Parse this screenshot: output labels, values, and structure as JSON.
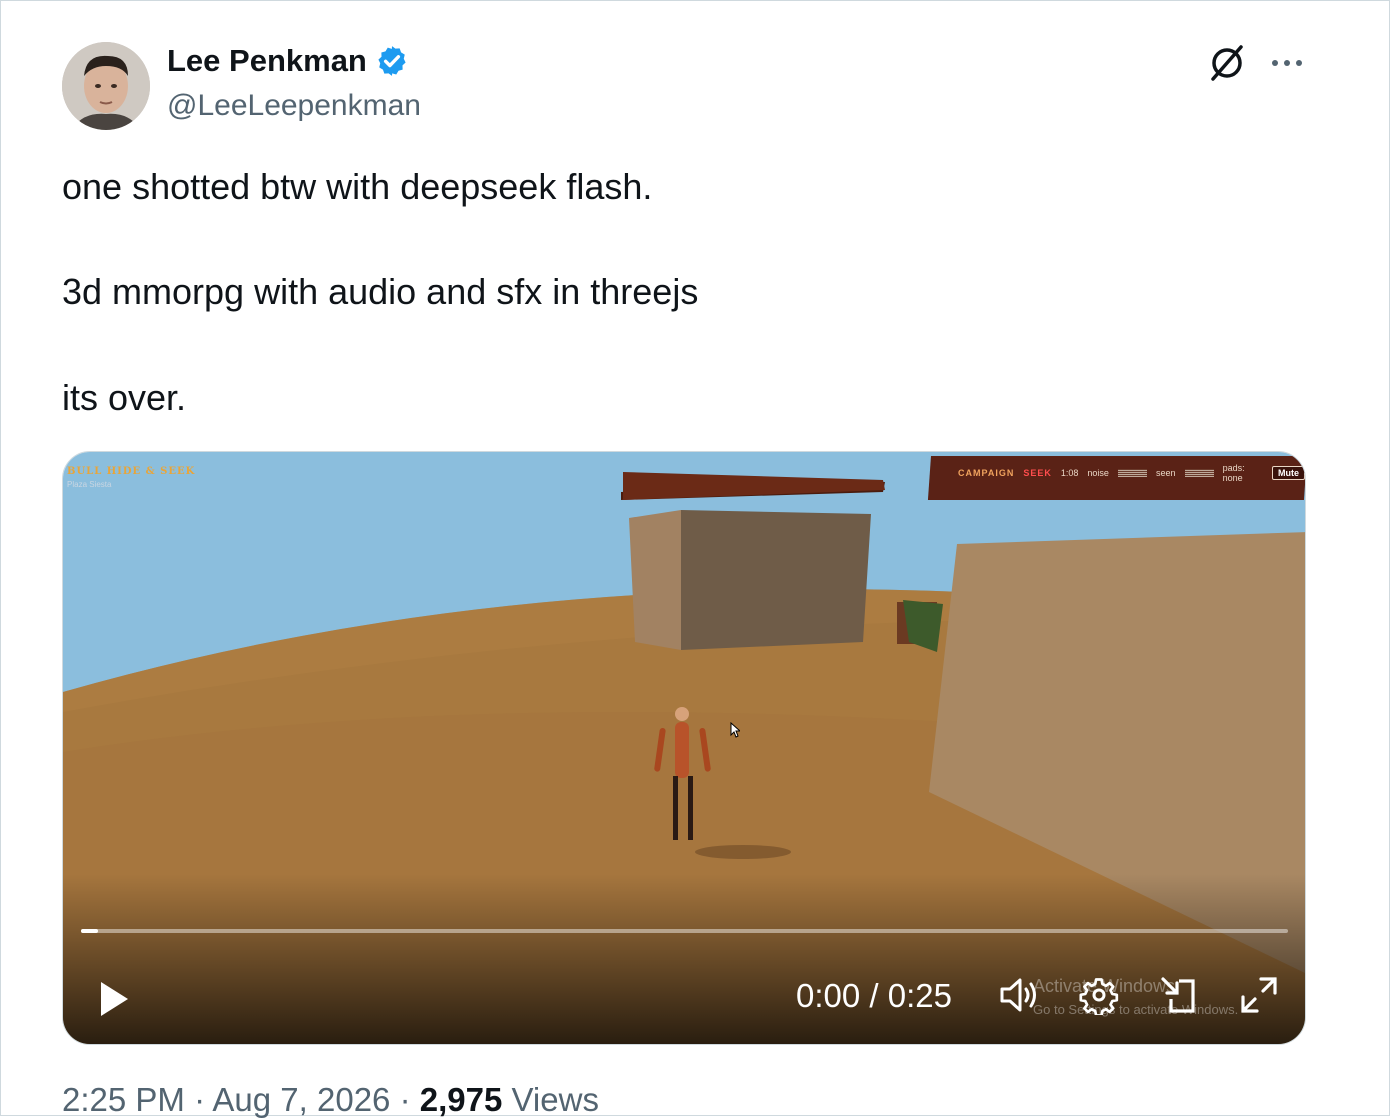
{
  "author": {
    "name": "Lee Penkman",
    "handle": "@LeeLeepenkman",
    "verified": true,
    "avatar_icon": "user-avatar"
  },
  "header_icons": [
    "grok-icon",
    "more-icon"
  ],
  "tweet": {
    "line1": "one shotted btw with deepseek flash.",
    "line2": "3d mmorpg with audio and sfx in threejs",
    "line3": "its over."
  },
  "video": {
    "game_title": "BULL HIDE & SEEK",
    "game_subtitle": "Plaza Siesta",
    "hud": {
      "mode": "CAMPAIGN",
      "role": "SEEK",
      "timer": "1:08",
      "noise_label": "noise",
      "seen_label": "seen",
      "pads_label": "pads: none",
      "mute_label": "Mute"
    },
    "time_display": "0:00 / 0:25",
    "progress_fraction": 0.014,
    "watermark_line1": "Activate Windows",
    "watermark_line2": "Go to Settings to activate Windows.",
    "controls": [
      "play-icon",
      "volume-icon",
      "settings-icon",
      "pip-icon",
      "fullscreen-icon"
    ],
    "colors": {
      "sky": "#8bbedd",
      "ground": "#a8793f",
      "wall": "#a98863"
    }
  },
  "meta": {
    "time": "2:25 PM",
    "date": "Aug 7, 2026",
    "views_count": "2,975",
    "views_label": "Views"
  }
}
